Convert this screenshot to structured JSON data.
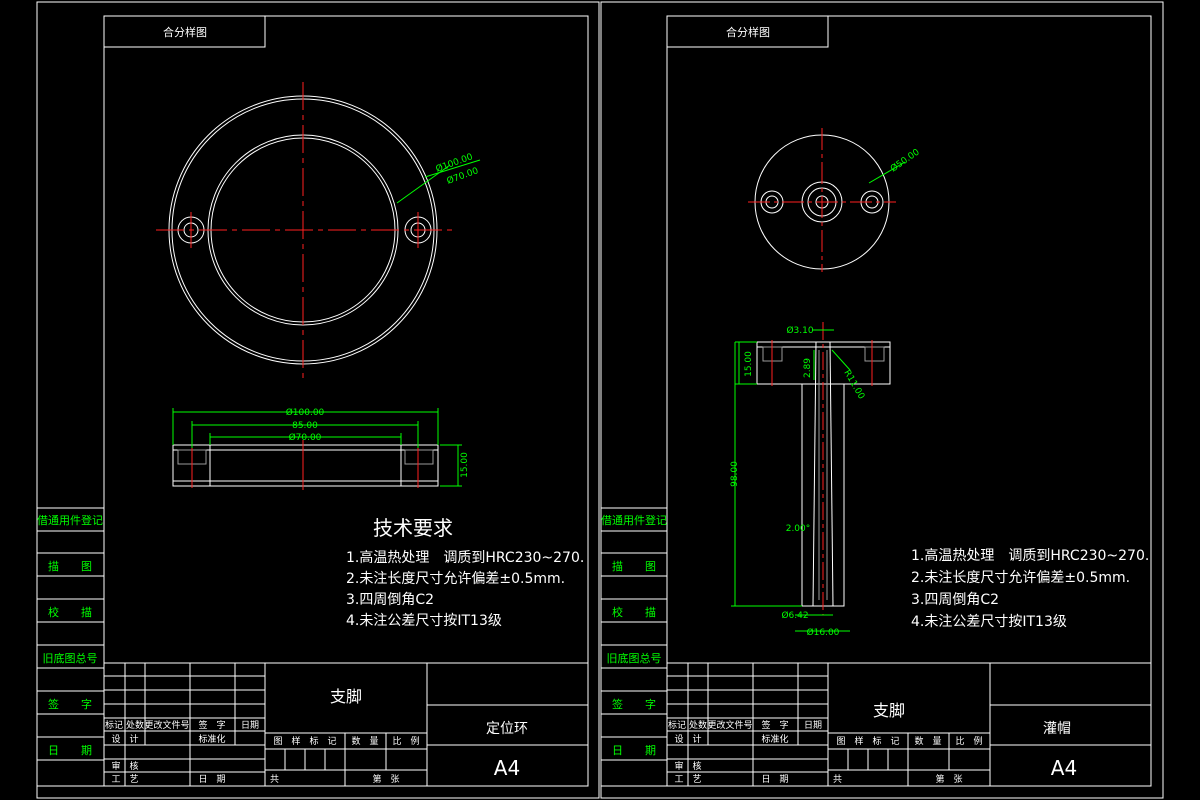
{
  "colors": {
    "background": "#000000",
    "line": "#ffffff",
    "center_line": "#ff2020",
    "dimension": "#00ff00"
  },
  "sheets": [
    {
      "header": "合分样图",
      "part_name": "支脚",
      "drawing_name": "定位环",
      "sheet_size": "A4",
      "tech_title": "技术要求",
      "tech_items": [
        "1.高温热处理　调质到HRC230~270.",
        "2.未注长度尺寸允许偏差±0.5mm.",
        "3.四周倒角C2",
        "4.未注公差尺寸按IT13级"
      ],
      "dims": {
        "d1": "Ø100.00",
        "d2": "Ø70.00",
        "w1": "Ø100.00",
        "w2": "85.00",
        "w3": "Ø70.00",
        "h": "15.00"
      }
    },
    {
      "header": "合分样图",
      "part_name": "支脚",
      "drawing_name": "灌帽",
      "sheet_size": "A4",
      "tech_title": "",
      "tech_items": [
        "1.高温热处理　调质到HRC230~270.",
        "2.未注长度尺寸允许偏差±0.5mm.",
        "3.四周倒角C2",
        "4.未注公差尺寸按IT13级"
      ],
      "dims": {
        "d1": "Ø50.00",
        "top": "Ø3.10",
        "r": "R11.00",
        "h1": "15.00",
        "h2": "2.89",
        "len": "98.00",
        "mid": "2.00°",
        "b1": "Ø6.42",
        "b2": "Ø16.00"
      }
    }
  ],
  "side_labels": [
    "借通用件登记",
    "描　　图",
    "校　　描",
    "旧底图总号",
    "签　　字",
    "日　　期"
  ],
  "title_block": {
    "rev_headers": [
      "标记",
      "处数",
      "更改文件号",
      "签　字",
      "日期"
    ],
    "sign_rows": [
      "设　计",
      "审　核",
      "工　艺"
    ],
    "standard": "标准化",
    "date": "日　期",
    "stage_headers": [
      "图　样　标　记",
      "数　量",
      "比　例"
    ],
    "sheet_of": "共",
    "sheet_no": "第　张"
  }
}
